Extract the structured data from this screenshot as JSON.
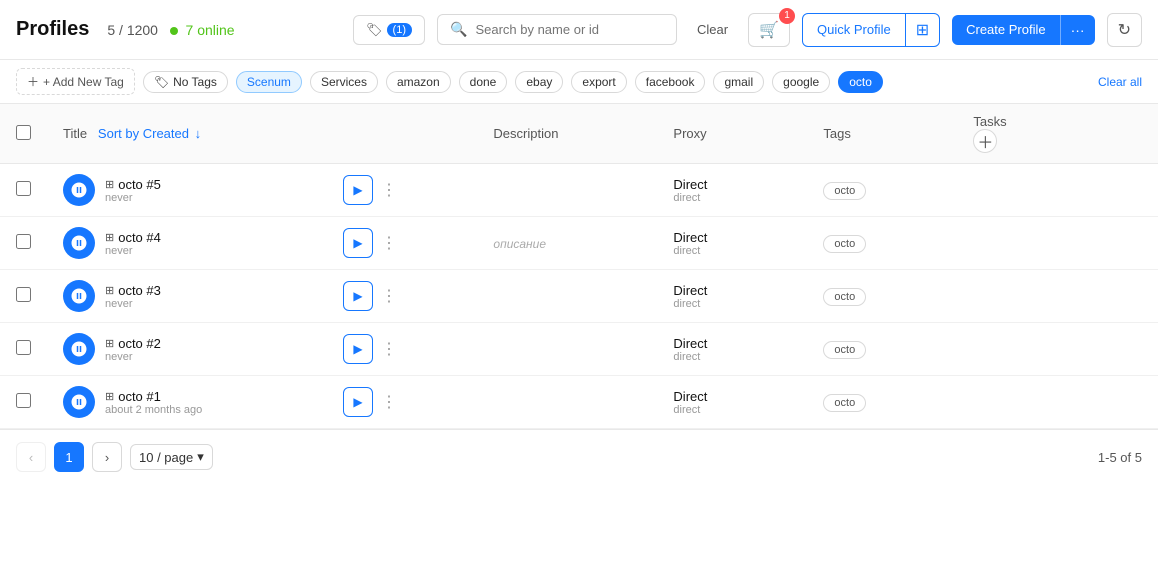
{
  "header": {
    "title": "Profiles",
    "count": "5 / 1200",
    "online_count": "7 online",
    "tag_filter_label": "(1)",
    "search_placeholder": "Search by name or id",
    "clear_label": "Clear",
    "cart_badge": "1",
    "quick_profile_label": "Quick Profile",
    "create_profile_label": "Create Profile",
    "dots_label": "···"
  },
  "tags_bar": {
    "add_new_tag": "+ Add New Tag",
    "no_tags": "No Tags",
    "tags": [
      "Scenum",
      "Services",
      "amazon",
      "done",
      "ebay",
      "export",
      "facebook",
      "gmail",
      "google",
      "octo"
    ],
    "active_tag": "octo",
    "clear_all": "Clear all"
  },
  "table": {
    "columns": {
      "title": "Title",
      "sort_label": "Sort by",
      "sort_field": "Created",
      "description": "Description",
      "proxy": "Proxy",
      "tags": "Tags",
      "tasks": "Tasks"
    },
    "rows": [
      {
        "id": 5,
        "name": "octo #5",
        "time": "never",
        "description": "",
        "proxy_name": "Direct",
        "proxy_type": "direct",
        "tag": "octo"
      },
      {
        "id": 4,
        "name": "octo #4",
        "time": "never",
        "description": "описание",
        "proxy_name": "Direct",
        "proxy_type": "direct",
        "tag": "octo"
      },
      {
        "id": 3,
        "name": "octo #3",
        "time": "never",
        "description": "",
        "proxy_name": "Direct",
        "proxy_type": "direct",
        "tag": "octo"
      },
      {
        "id": 2,
        "name": "octo #2",
        "time": "never",
        "description": "",
        "proxy_name": "Direct",
        "proxy_type": "direct",
        "tag": "octo"
      },
      {
        "id": 1,
        "name": "octo #1",
        "time": "about 2 months ago",
        "description": "",
        "proxy_name": "Direct",
        "proxy_type": "direct",
        "tag": "octo"
      }
    ]
  },
  "footer": {
    "current_page": "1",
    "page_size": "10 / page",
    "total": "1-5 of 5"
  }
}
